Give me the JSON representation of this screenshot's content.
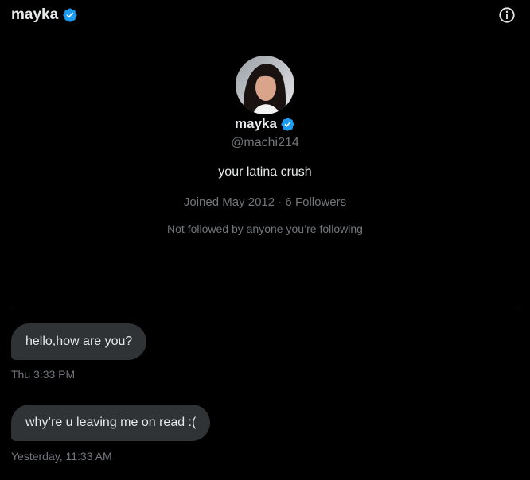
{
  "header": {
    "title": "mayka",
    "verified_icon": "verified-badge-icon",
    "info_icon": "info-icon"
  },
  "profile": {
    "name": "mayka",
    "handle": "@machi214",
    "bio": "your latina crush",
    "meta": "Joined May 2012 · 6 Followers",
    "mutuals": "Not followed by anyone you’re following",
    "avatar_icon": "profile-avatar"
  },
  "messages": [
    {
      "text": "hello,how are you?",
      "time": "Thu 3:33 PM"
    },
    {
      "text": "why’re u leaving me on read :(",
      "time": "Yesterday, 11:33 AM"
    }
  ],
  "colors": {
    "background": "#000000",
    "text_primary": "#e7e9ea",
    "text_secondary": "#71767b",
    "bubble": "#2f3336",
    "verified": "#1d9bf0"
  }
}
